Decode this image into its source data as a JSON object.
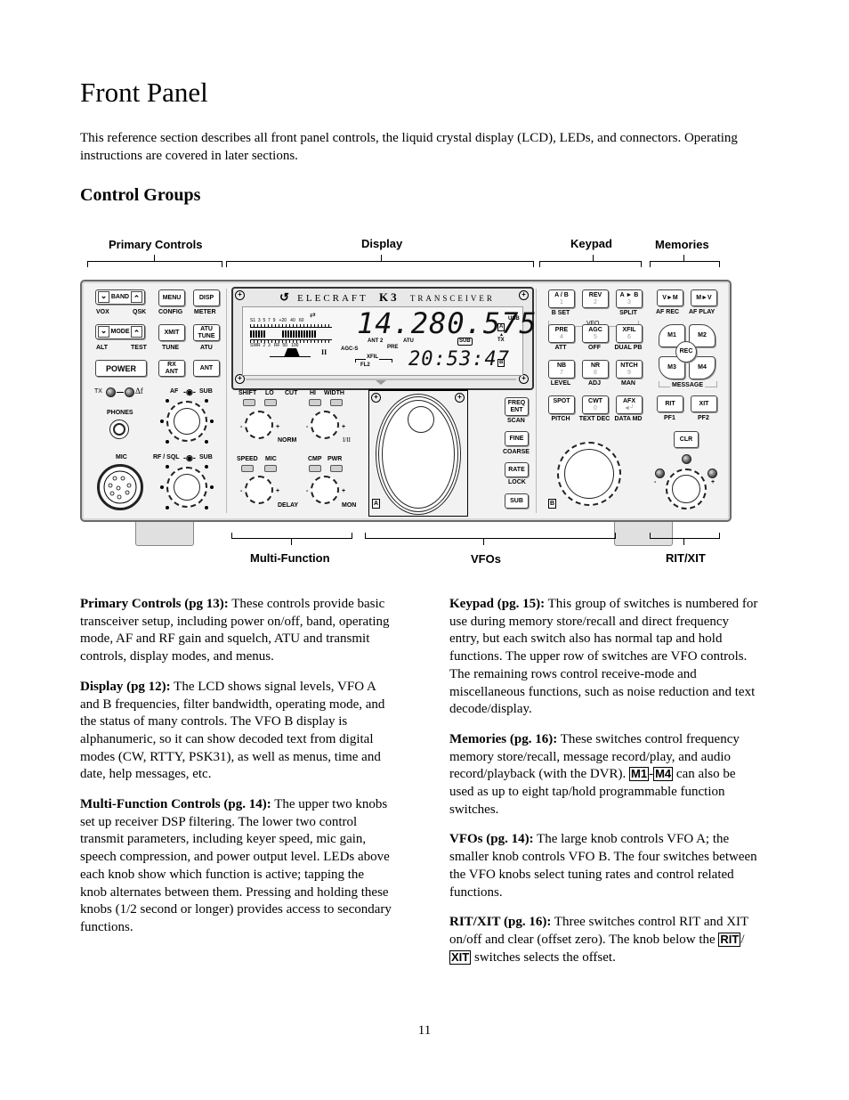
{
  "page": {
    "title": "Front Panel",
    "intro": "This reference section describes all front panel controls, the liquid crystal display (LCD), LEDs, and connectors. Operating instructions are covered in later sections.",
    "section_heading": "Control Groups",
    "page_number": "11"
  },
  "diagram": {
    "group_labels": {
      "primary_controls": "Primary Controls",
      "display": "Display",
      "keypad": "Keypad",
      "memories": "Memories",
      "multi_function": "Multi-Function",
      "vfos": "VFOs",
      "rit_xit": "RIT/XIT"
    },
    "primary": {
      "band": "BAND",
      "band_down": "⌄",
      "band_up": "⌃",
      "vox": "VOX",
      "qsk": "QSK",
      "menu": "MENU",
      "config": "CONFIG",
      "disp": "DISP",
      "meter": "METER",
      "mode": "MODE",
      "alt": "ALT",
      "test": "TEST",
      "xmit": "XMIT",
      "tune": "TUNE",
      "atu_tune_1": "ATU",
      "atu_tune_2": "TUNE",
      "atu": "ATU",
      "power": "POWER",
      "rx_ant_1": "RX",
      "rx_ant_2": "ANT",
      "ant": "ANT",
      "tx": "TX",
      "delta_f": "Δf",
      "phones": "PHONES",
      "mic": "MIC",
      "af": "AF",
      "af_sub": "SUB",
      "rf_sql": "RF / SQL",
      "rf_sub": "SUB"
    },
    "lcd": {
      "brand": "ELECRAFT",
      "model": "K3",
      "product": "TRANSCEIVER",
      "s_scale": "S1  3  5  7  9   +20   40   60",
      "swr_scale": "SWR  2  3   RF  50   100",
      "vfo_a_freq": "14.280.575",
      "vfo_b_text": "20:53:47",
      "mode": "USB",
      "vfo_a_tag": "A",
      "vfo_b_tag": "B",
      "tx": "TX",
      "sub": "SUB",
      "ant": "ANT 2",
      "atu": "ATU",
      "pre": "PRE",
      "agc": "AGC-S",
      "xfil": "XFIL",
      "fl2": "FL2",
      "ii": "II"
    },
    "multi_function": {
      "shift": "SHIFT",
      "lo": "LO",
      "cut": "CUT",
      "hi": "HI",
      "width": "WIDTH",
      "norm": "NORM",
      "i_ii": "I/II",
      "speed": "SPEED",
      "mic": "MIC",
      "cmp": "CMP",
      "pwr": "PWR",
      "delay": "DELAY",
      "mon": "MON",
      "minus": "-",
      "plus": "+"
    },
    "vfo": {
      "freq_ent_1": "FREQ",
      "freq_ent_2": "ENT",
      "scan": "SCAN",
      "fine": "FINE",
      "coarse": "COARSE",
      "rate": "RATE",
      "lock": "LOCK",
      "sub": "SUB",
      "a_tag": "A",
      "b_tag": "B"
    },
    "keypad": {
      "rows": [
        [
          {
            "label": "A / B",
            "num": "1",
            "sub": "B SET"
          },
          {
            "label": "REV",
            "num": "2",
            "sub": ""
          },
          {
            "label": "A ► B",
            "num": "3",
            "sub": "SPLIT"
          }
        ],
        [
          {
            "label": "PRE",
            "num": "4",
            "sub": "ATT"
          },
          {
            "label": "AGC",
            "num": "5",
            "sub": "OFF"
          },
          {
            "label": "XFIL",
            "num": "6",
            "sub": "DUAL PB"
          }
        ],
        [
          {
            "label": "NB",
            "num": "7",
            "sub": "LEVEL"
          },
          {
            "label": "NR",
            "num": "8",
            "sub": "ADJ"
          },
          {
            "label": "NTCH",
            "num": "9",
            "sub": "MAN"
          }
        ],
        [
          {
            "label": "SPOT",
            "num": "·",
            "sub": "PITCH"
          },
          {
            "label": "CWT",
            "num": "0",
            "sub": "TEXT DEC"
          },
          {
            "label": "AFX",
            "num": "◄┘",
            "sub": "DATA MD"
          }
        ]
      ],
      "vfo_group": "VFO"
    },
    "memories": {
      "v_to_m": "V►M",
      "m_to_v": "M►V",
      "af_rec": "AF REC",
      "af_play": "AF PLAY",
      "m1": "M1",
      "m2": "M2",
      "m3": "M3",
      "m4": "M4",
      "rec": "REC",
      "message": "MESSAGE"
    },
    "rit_xit": {
      "rit": "RIT",
      "xit": "XIT",
      "pf1": "PF1",
      "pf2": "PF2",
      "clr": "CLR",
      "minus": "-",
      "plus": "+"
    }
  },
  "descriptions": {
    "left": [
      {
        "heading": "Primary Controls (pg 13):",
        "text": "   These controls provide basic transceiver setup, including power on/off,  band, operating mode, AF and RF gain and squelch, ATU and transmit controls, display modes, and menus."
      },
      {
        "heading": "Display (pg 12):",
        "text": "  The LCD shows signal levels, VFO A and B frequencies, filter bandwidth, operating mode, and the status of many controls. The VFO B display is alphanumeric, so it can show decoded text from digital modes (CW, RTTY, PSK31), as well as menus, time and date, help messages, etc."
      },
      {
        "heading": "Multi-Function Controls (pg. 14):",
        "text": " The upper two knobs set up receiver DSP filtering. The lower two control transmit parameters, including keyer speed, mic gain, speech compression, and power output level. LEDs above each knob show which function is active; tapping the knob alternates between them. Pressing and holding these knobs (1/2 second or longer) provides access to secondary functions."
      }
    ],
    "right": {
      "keypad": {
        "heading": "Keypad (pg. 15):",
        "text": "  This group of switches is numbered for use during memory store/recall and direct frequency entry, but each switch also has normal tap and hold functions. The upper row of switches are VFO controls. The remaining rows control receive-mode and miscellaneous functions, such as noise reduction and text decode/display."
      },
      "memories": {
        "heading": "Memories (pg. 16):",
        "text_before": " These switches control frequency memory store/recall, message record/play, and audio record/playback (with the DVR). ",
        "key1": "M1",
        "dash": "-",
        "key2": "M4",
        "text_after": " can also be used as up to eight tap/hold programmable function switches."
      },
      "vfos": {
        "heading": "VFOs (pg. 14):",
        "text": "  The large knob controls VFO A; the smaller knob controls VFO B. The four switches between the VFO knobs select tuning rates and control related functions."
      },
      "rit_xit": {
        "heading": "RIT/XIT (pg. 16):",
        "text_before": "  Three switches control RIT and XIT on/off and clear (offset zero). The knob below the ",
        "key1": "RIT",
        "slash": "/",
        "key2": "XIT",
        "text_after": " switches selects the offset."
      }
    }
  }
}
